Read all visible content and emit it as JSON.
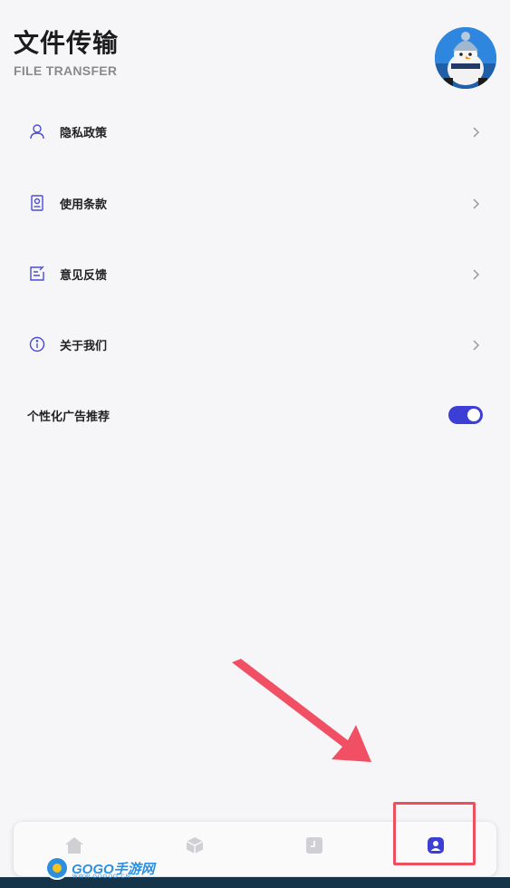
{
  "header": {
    "title": "文件传输",
    "subtitle": "FILE TRANSFER"
  },
  "menu": {
    "items": [
      {
        "label": "隐私政策",
        "icon": "person-icon"
      },
      {
        "label": "使用条款",
        "icon": "document-icon"
      },
      {
        "label": "意见反馈",
        "icon": "feedback-icon"
      },
      {
        "label": "关于我们",
        "icon": "info-icon"
      }
    ],
    "ad_toggle": {
      "label": "个性化广告推荐",
      "on": true
    }
  },
  "tabbar": {
    "tabs": [
      {
        "icon": "home-icon",
        "active": false
      },
      {
        "icon": "box-icon",
        "active": false
      },
      {
        "icon": "clock-icon",
        "active": false
      },
      {
        "icon": "profile-icon",
        "active": true
      }
    ]
  },
  "watermark": {
    "text": "GOGO手游网",
    "sub": "WWW.GOGOO.CN"
  },
  "colors": {
    "accent": "#3d3ed6",
    "icon_stroke": "#4a4cd8",
    "highlight": "#ee4f5e",
    "inactive_tab": "#d0d0d4"
  }
}
